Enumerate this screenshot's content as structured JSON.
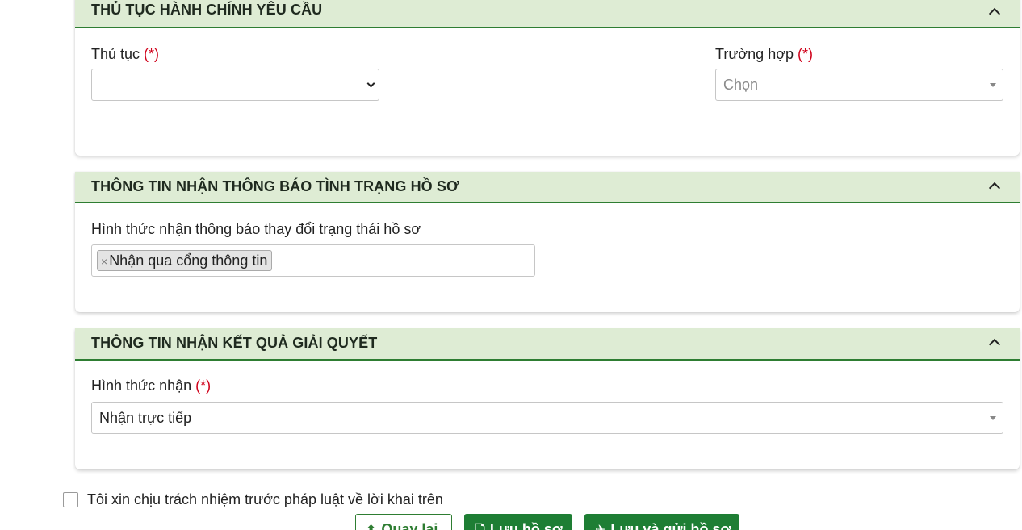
{
  "sections": {
    "procedure": {
      "title": "THỦ TỤC HÀNH CHÍNH YÊU CẦU",
      "procedure_label": "Thủ tục",
      "procedure_required": "(*)",
      "procedure_value": "",
      "case_label": "Trường hợp",
      "case_required": "(*)",
      "case_placeholder": "Chọn"
    },
    "notification": {
      "title": "THÔNG TIN NHẬN THÔNG BÁO TÌNH TRẠNG HỒ SƠ",
      "method_label": "Hình thức nhận thông báo thay đổi trạng thái hồ sơ",
      "tag_remove": "×",
      "tag_label": "Nhận qua cổng thông tin"
    },
    "result": {
      "title": "THÔNG TIN NHẬN KẾT QUẢ GIẢI QUYẾT",
      "method_label": "Hình thức nhận",
      "method_required": "(*)",
      "method_value": "Nhận trực tiếp"
    }
  },
  "commitment": {
    "label": "Tôi xin chịu trách nhiệm trước pháp luật về lời khai trên",
    "checked": false
  },
  "actions": {
    "back_label": "Quay lại",
    "back_icon": "arrow-up-icon",
    "save_label": "Lưu hồ sơ",
    "save_icon": "file-icon",
    "send_label": "Lưu và gửi hồ sơ",
    "send_icon": "paper-plane-icon"
  },
  "colors": {
    "header_bg": "#deecd4",
    "header_border": "#2e7d32",
    "required": "#d0021b",
    "button_green": "#1e7e34"
  }
}
